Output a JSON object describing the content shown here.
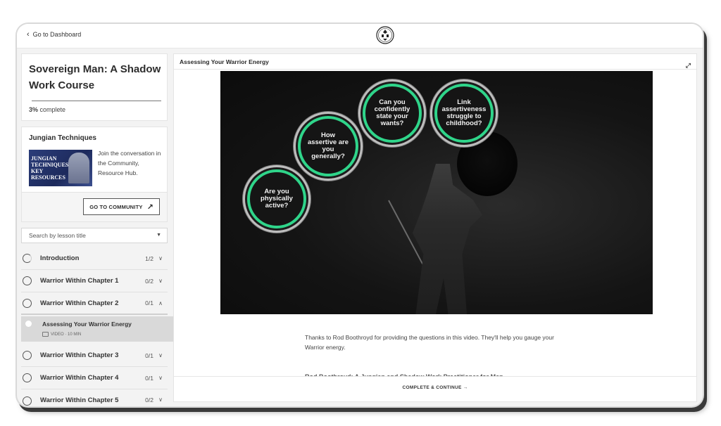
{
  "topbar": {
    "back_label": "Go to Dashboard",
    "logo_icon": "crest-logo-icon"
  },
  "course": {
    "title": "Sovereign Man: A Shadow Work Course",
    "progress_percent": "3%",
    "progress_suffix": " complete"
  },
  "promo": {
    "title": "Jungian Techniques",
    "thumb_text": "JUNGIAN TECHNIQUES KEY RESOURCES",
    "text": "Join the conversation in the Community, Resource Hub.",
    "button_label": "GO TO COMMUNITY"
  },
  "search": {
    "placeholder": "Search by lesson title"
  },
  "chapters": [
    {
      "name": "Introduction",
      "count": "1/2",
      "state": "partial",
      "expanded": false
    },
    {
      "name": "Warrior Within Chapter 1",
      "count": "0/2",
      "state": "empty",
      "expanded": false
    },
    {
      "name": "Warrior Within Chapter 2",
      "count": "0/1",
      "state": "empty",
      "expanded": true
    },
    {
      "name": "Warrior Within Chapter 3",
      "count": "0/1",
      "state": "empty",
      "expanded": false
    },
    {
      "name": "Warrior Within Chapter 4",
      "count": "0/1",
      "state": "empty",
      "expanded": false
    },
    {
      "name": "Warrior Within Chapter 5",
      "count": "0/2",
      "state": "empty",
      "expanded": false
    }
  ],
  "active_lesson": {
    "name": "Assessing Your Warrior Energy",
    "meta": "VIDEO · 10 MIN"
  },
  "main": {
    "header_title": "Assessing Your Warrior Energy",
    "video_bubbles": [
      "Are you physically active?",
      "How assertive are you generally?",
      "Can you confidently state your wants?",
      "Link assertiveness struggle to childhood?"
    ],
    "body_text": "Thanks to Rod Boothroyd for providing the questions in this video. They'll help you gauge your Warrior energy.",
    "cut_text": "Rod Boothroyd: A Jungian and Shadow Work Practitioner for Men",
    "complete_label": "COMPLETE & CONTINUE →"
  },
  "colors": {
    "accent_green": "#2fd58a",
    "active_row": "#d9d9d9"
  }
}
